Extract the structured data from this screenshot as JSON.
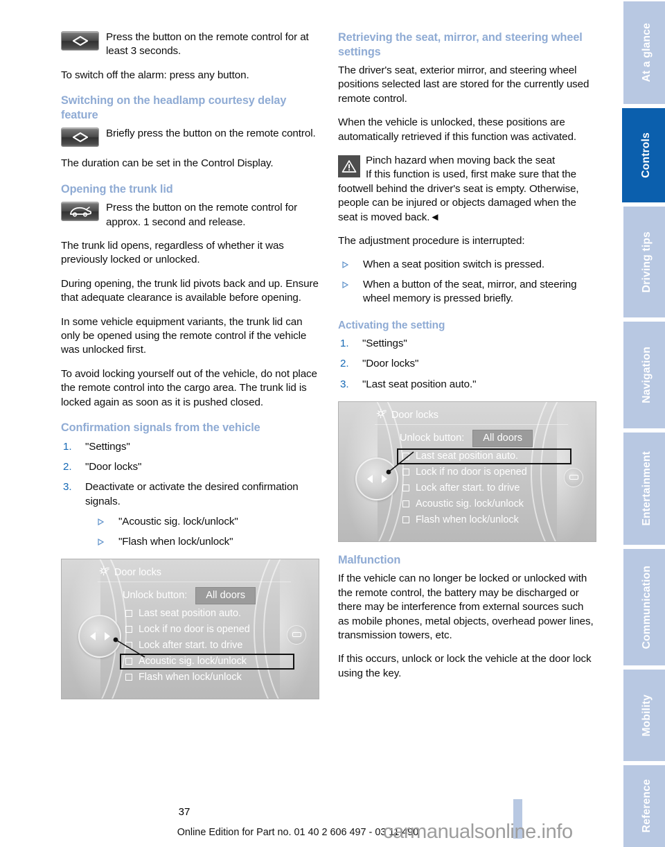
{
  "left_column": {
    "remote_press_3s": {
      "icon": "key-remote-lock-button-icon",
      "text": "Press the button on the remote control for at least 3 seconds."
    },
    "alarm_off": "To switch off the alarm: press any button.",
    "headlamp_heading": "Switching on the headlamp courtesy delay feature",
    "remote_brief_press": {
      "icon": "key-remote-lock-button-icon",
      "text": "Briefly press the button on the remote control."
    },
    "duration_note": "The duration can be set in the Control Display.",
    "trunk_heading": "Opening the trunk lid",
    "remote_trunk_press": {
      "icon": "key-remote-trunk-button-icon",
      "text": "Press the button on the remote control for approx. 1 second and release."
    },
    "trunk_p1": "The trunk lid opens, regardless of whether it was previously locked or unlocked.",
    "trunk_p2": "During opening, the trunk lid pivots back and up. Ensure that adequate clearance is available before opening.",
    "trunk_p3": "In some vehicle equipment variants, the trunk lid can only be opened using the remote control if the vehicle was unlocked first.",
    "trunk_p4": "To avoid locking yourself out of the vehicle, do not place the remote control into the cargo area. The trunk lid is locked again as soon as it is pushed closed.",
    "confirmation_heading": "Confirmation signals from the vehicle",
    "confirmation_steps": [
      {
        "num": "1.",
        "text": "\"Settings\""
      },
      {
        "num": "2.",
        "text": "\"Door locks\""
      },
      {
        "num": "3.",
        "text": "Deactivate or activate the desired confirmation signals.",
        "sub": [
          "\"Acoustic sig. lock/unlock\"",
          "\"Flash when lock/unlock\""
        ]
      }
    ],
    "idrive": {
      "title": "Door locks",
      "title_icon": "settings-gear-icon",
      "unlock_label": "Unlock button:",
      "unlock_value": "All doors",
      "options": [
        {
          "label": "Last seat position auto.",
          "selected": false
        },
        {
          "label": "Lock if no door is opened",
          "selected": false
        },
        {
          "label": "Lock after start. to drive",
          "selected": false
        },
        {
          "label": "Acoustic sig. lock/unlock",
          "selected": true
        },
        {
          "label": "Flash when lock/unlock",
          "selected": false
        }
      ]
    }
  },
  "right_column": {
    "retrieving_heading": "Retrieving the seat, mirror, and steering wheel settings",
    "retrieve_p1": "The driver's seat, exterior mirror, and steering wheel positions selected last are stored for the currently used remote control.",
    "retrieve_p2": "When the vehicle is unlocked, these positions are automatically retrieved if this function was activated.",
    "warning": {
      "icon": "warning-triangle-icon",
      "title": "Pinch hazard when moving back the seat",
      "text": "If this function is used, first make sure that the footwell behind the driver's seat is empty. Otherwise, people can be injured or objects damaged when the seat is moved back.◄"
    },
    "interrupt_intro": "The adjustment procedure is interrupted:",
    "interrupt_items": [
      "When a seat position switch is pressed.",
      "When a button of the seat, mirror, and steering wheel memory is pressed briefly."
    ],
    "activating_heading": "Activating the setting",
    "activating_steps": [
      {
        "num": "1.",
        "text": "\"Settings\""
      },
      {
        "num": "2.",
        "text": "\"Door locks\""
      },
      {
        "num": "3.",
        "text": "\"Last seat position auto.\""
      }
    ],
    "idrive": {
      "title": "Door locks",
      "title_icon": "settings-gear-icon",
      "unlock_label": "Unlock button:",
      "unlock_value": "All doors",
      "options": [
        {
          "label": "Last seat position auto.",
          "selected": true
        },
        {
          "label": "Lock if no door is opened",
          "selected": false
        },
        {
          "label": "Lock after start. to drive",
          "selected": false
        },
        {
          "label": "Acoustic sig. lock/unlock",
          "selected": false
        },
        {
          "label": "Flash when lock/unlock",
          "selected": false
        }
      ]
    },
    "malfunction_heading": "Malfunction",
    "malfunction_p1": "If the vehicle can no longer be locked or unlocked with the remote control, the battery may be discharged or there may be interference from external sources such as mobile phones, metal objects, overhead power lines, transmission towers, etc.",
    "malfunction_p2": "If this occurs, unlock or lock the vehicle at the door lock using the key."
  },
  "nav_tabs": [
    {
      "label": "At a glance",
      "active": false
    },
    {
      "label": "Controls",
      "active": true
    },
    {
      "label": "Driving tips",
      "active": false
    },
    {
      "label": "Navigation",
      "active": false
    },
    {
      "label": "Entertainment",
      "active": false
    },
    {
      "label": "Communication",
      "active": false
    },
    {
      "label": "Mobility",
      "active": false
    },
    {
      "label": "Reference",
      "active": false
    }
  ],
  "footer": {
    "page_number": "37",
    "edition_line": "Online Edition for Part no. 01 40 2 606 497 - 03 11 490",
    "watermark": "carmanualsonline.info"
  },
  "colors": {
    "heading_blue": "#8fabd4",
    "list_number_blue": "#1669b5",
    "tab_inactive": "#b8c8e2",
    "tab_active": "#0b5fad"
  }
}
